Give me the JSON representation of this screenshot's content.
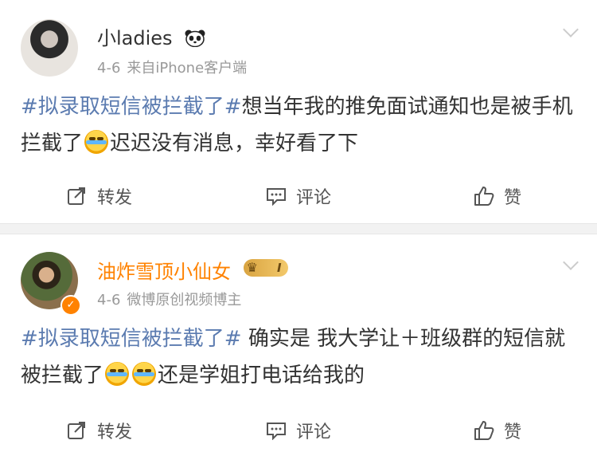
{
  "posts": [
    {
      "username": "小ladies",
      "date": "4-6",
      "source": "来自iPhone客户端",
      "hashtag": "#拟录取短信被拦截了#",
      "text_a": "想当年我的推免面试通知也是被手机拦截了",
      "text_b": "迟迟没有消息，幸好看了下",
      "actions": {
        "repost": "转发",
        "comment": "评论",
        "like": "赞"
      }
    },
    {
      "username": "油炸雪顶小仙女",
      "member_level": "I",
      "date": "4-6",
      "source": "微博原创视频博主",
      "hashtag": "#拟录取短信被拦截了#",
      "text_a": " 确实是 我大学让＋班级群的短信就被拦截了",
      "text_b": "还是学姐打电话给我的",
      "actions": {
        "repost": "转发",
        "comment": "评论",
        "like": "赞"
      }
    }
  ],
  "colors": {
    "hashtag": "#5b7bb0",
    "vip_name": "#ff8200",
    "meta": "#999999",
    "divider": "#f2f2f2"
  },
  "icons": [
    "panda-emoji-icon",
    "member-crown-icon",
    "verified-badge-icon",
    "chevron-down-icon",
    "repost-icon",
    "comment-icon",
    "like-icon",
    "laugh-cry-emoji-icon"
  ]
}
